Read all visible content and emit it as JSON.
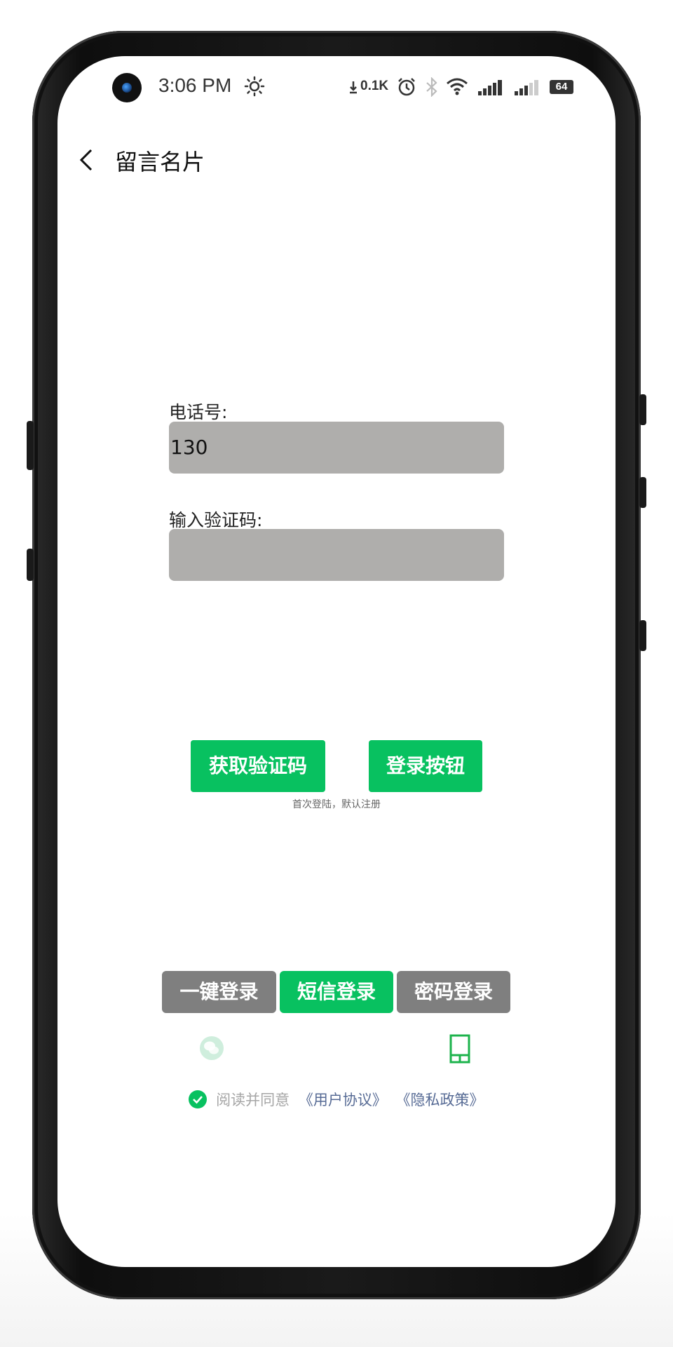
{
  "status_bar": {
    "time": "3:06 PM",
    "net_speed": "0.1K",
    "battery": "64"
  },
  "header": {
    "title": "留言名片"
  },
  "form": {
    "phone_label": "电话号:",
    "phone_value": "130",
    "code_label": "输入验证码:",
    "code_value": ""
  },
  "actions": {
    "get_code_label": "获取验证码",
    "login_label": "登录按钮",
    "hint": "首次登陆，默认注册"
  },
  "login_tabs": [
    {
      "label": "一键登录",
      "active": false
    },
    {
      "label": "短信登录",
      "active": true
    },
    {
      "label": "密码登录",
      "active": false
    }
  ],
  "icons": {
    "left": "wechat-icon",
    "right": "phone-icon"
  },
  "agreement": {
    "text": "阅读并同意",
    "user_agreement": "《用户协议》",
    "privacy_policy": "《隐私政策》"
  },
  "colors": {
    "accent": "#08c160",
    "input_bg": "#afaeac",
    "tab_inactive": "#7f7f7f",
    "link": "#576b95"
  }
}
